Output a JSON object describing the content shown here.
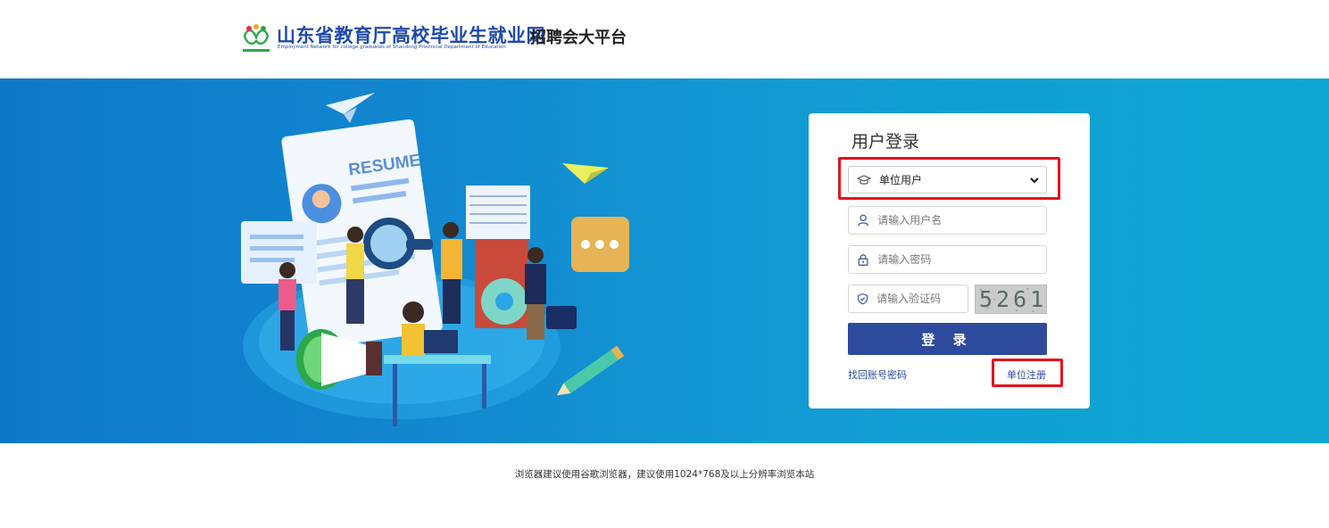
{
  "header": {
    "site_title": "山东省教育厅高校毕业生就业网",
    "site_subtitle_en": "Employment Network for college graduates of Shandong Provincial Department of Education",
    "platform_suffix": "招聘会大平台"
  },
  "login": {
    "title": "用户登录",
    "user_type": {
      "selected": "单位用户"
    },
    "username": {
      "placeholder": "请输入用户名"
    },
    "password": {
      "placeholder": "请输入密码"
    },
    "captcha": {
      "placeholder": "请输入验证码",
      "image_text": "5261"
    },
    "submit_label": "登 录",
    "forgot_label": "找回账号密码",
    "register_label": "单位注册"
  },
  "illustration": {
    "resume_text": "RESUME"
  },
  "footer": {
    "notice": "浏览器建议使用谷歌浏览器，建议使用1024*768及以上分辨率浏览本站"
  },
  "colors": {
    "brand": "#1f4aa8",
    "button": "#2d4a9c",
    "highlight": "#e8101c"
  },
  "icons": [
    "logo-icon",
    "graduation-cap-icon",
    "chevron-down-icon",
    "user-icon",
    "lock-icon",
    "shield-icon"
  ]
}
